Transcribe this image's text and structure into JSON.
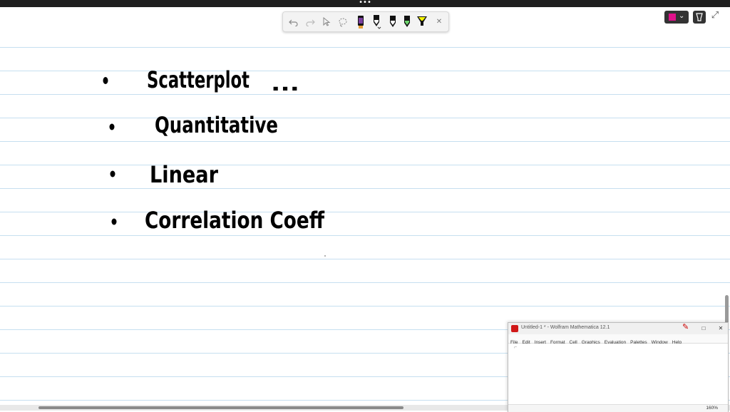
{
  "app_topbar": {
    "handle": "•••"
  },
  "toolbar": {
    "undo_icon": "undo-icon",
    "redo_icon": "redo-icon",
    "select_icon": "select-arrow-icon",
    "lasso_icon": "lasso-icon",
    "close_label": "✕",
    "pens": [
      {
        "name": "pen-purple",
        "color": "#7a3fa0"
      },
      {
        "name": "pen-black",
        "color": "#000000"
      },
      {
        "name": "pen-black-2",
        "color": "#000000"
      },
      {
        "name": "pen-green",
        "color": "#6cd46c"
      },
      {
        "name": "highlighter-yellow",
        "color": "#f4f400"
      }
    ]
  },
  "right_tools": {
    "ink_color": "#e0118a",
    "expand_label": "⤢"
  },
  "notes": {
    "items": [
      {
        "text": "Scatterplot",
        "suffix": "..."
      },
      {
        "text": "Quantitative"
      },
      {
        "text": "Linear"
      },
      {
        "text": "Correlation Coeff"
      }
    ]
  },
  "mathematica": {
    "title": "Untitled-1 * - Wolfram Mathematica 12.1",
    "menu": [
      "File",
      "Edit",
      "Insert",
      "Format",
      "Cell",
      "Graphics",
      "Evaluation",
      "Palettes",
      "Window",
      "Help"
    ],
    "cell_marker": "⌐",
    "zoom": "160%"
  }
}
